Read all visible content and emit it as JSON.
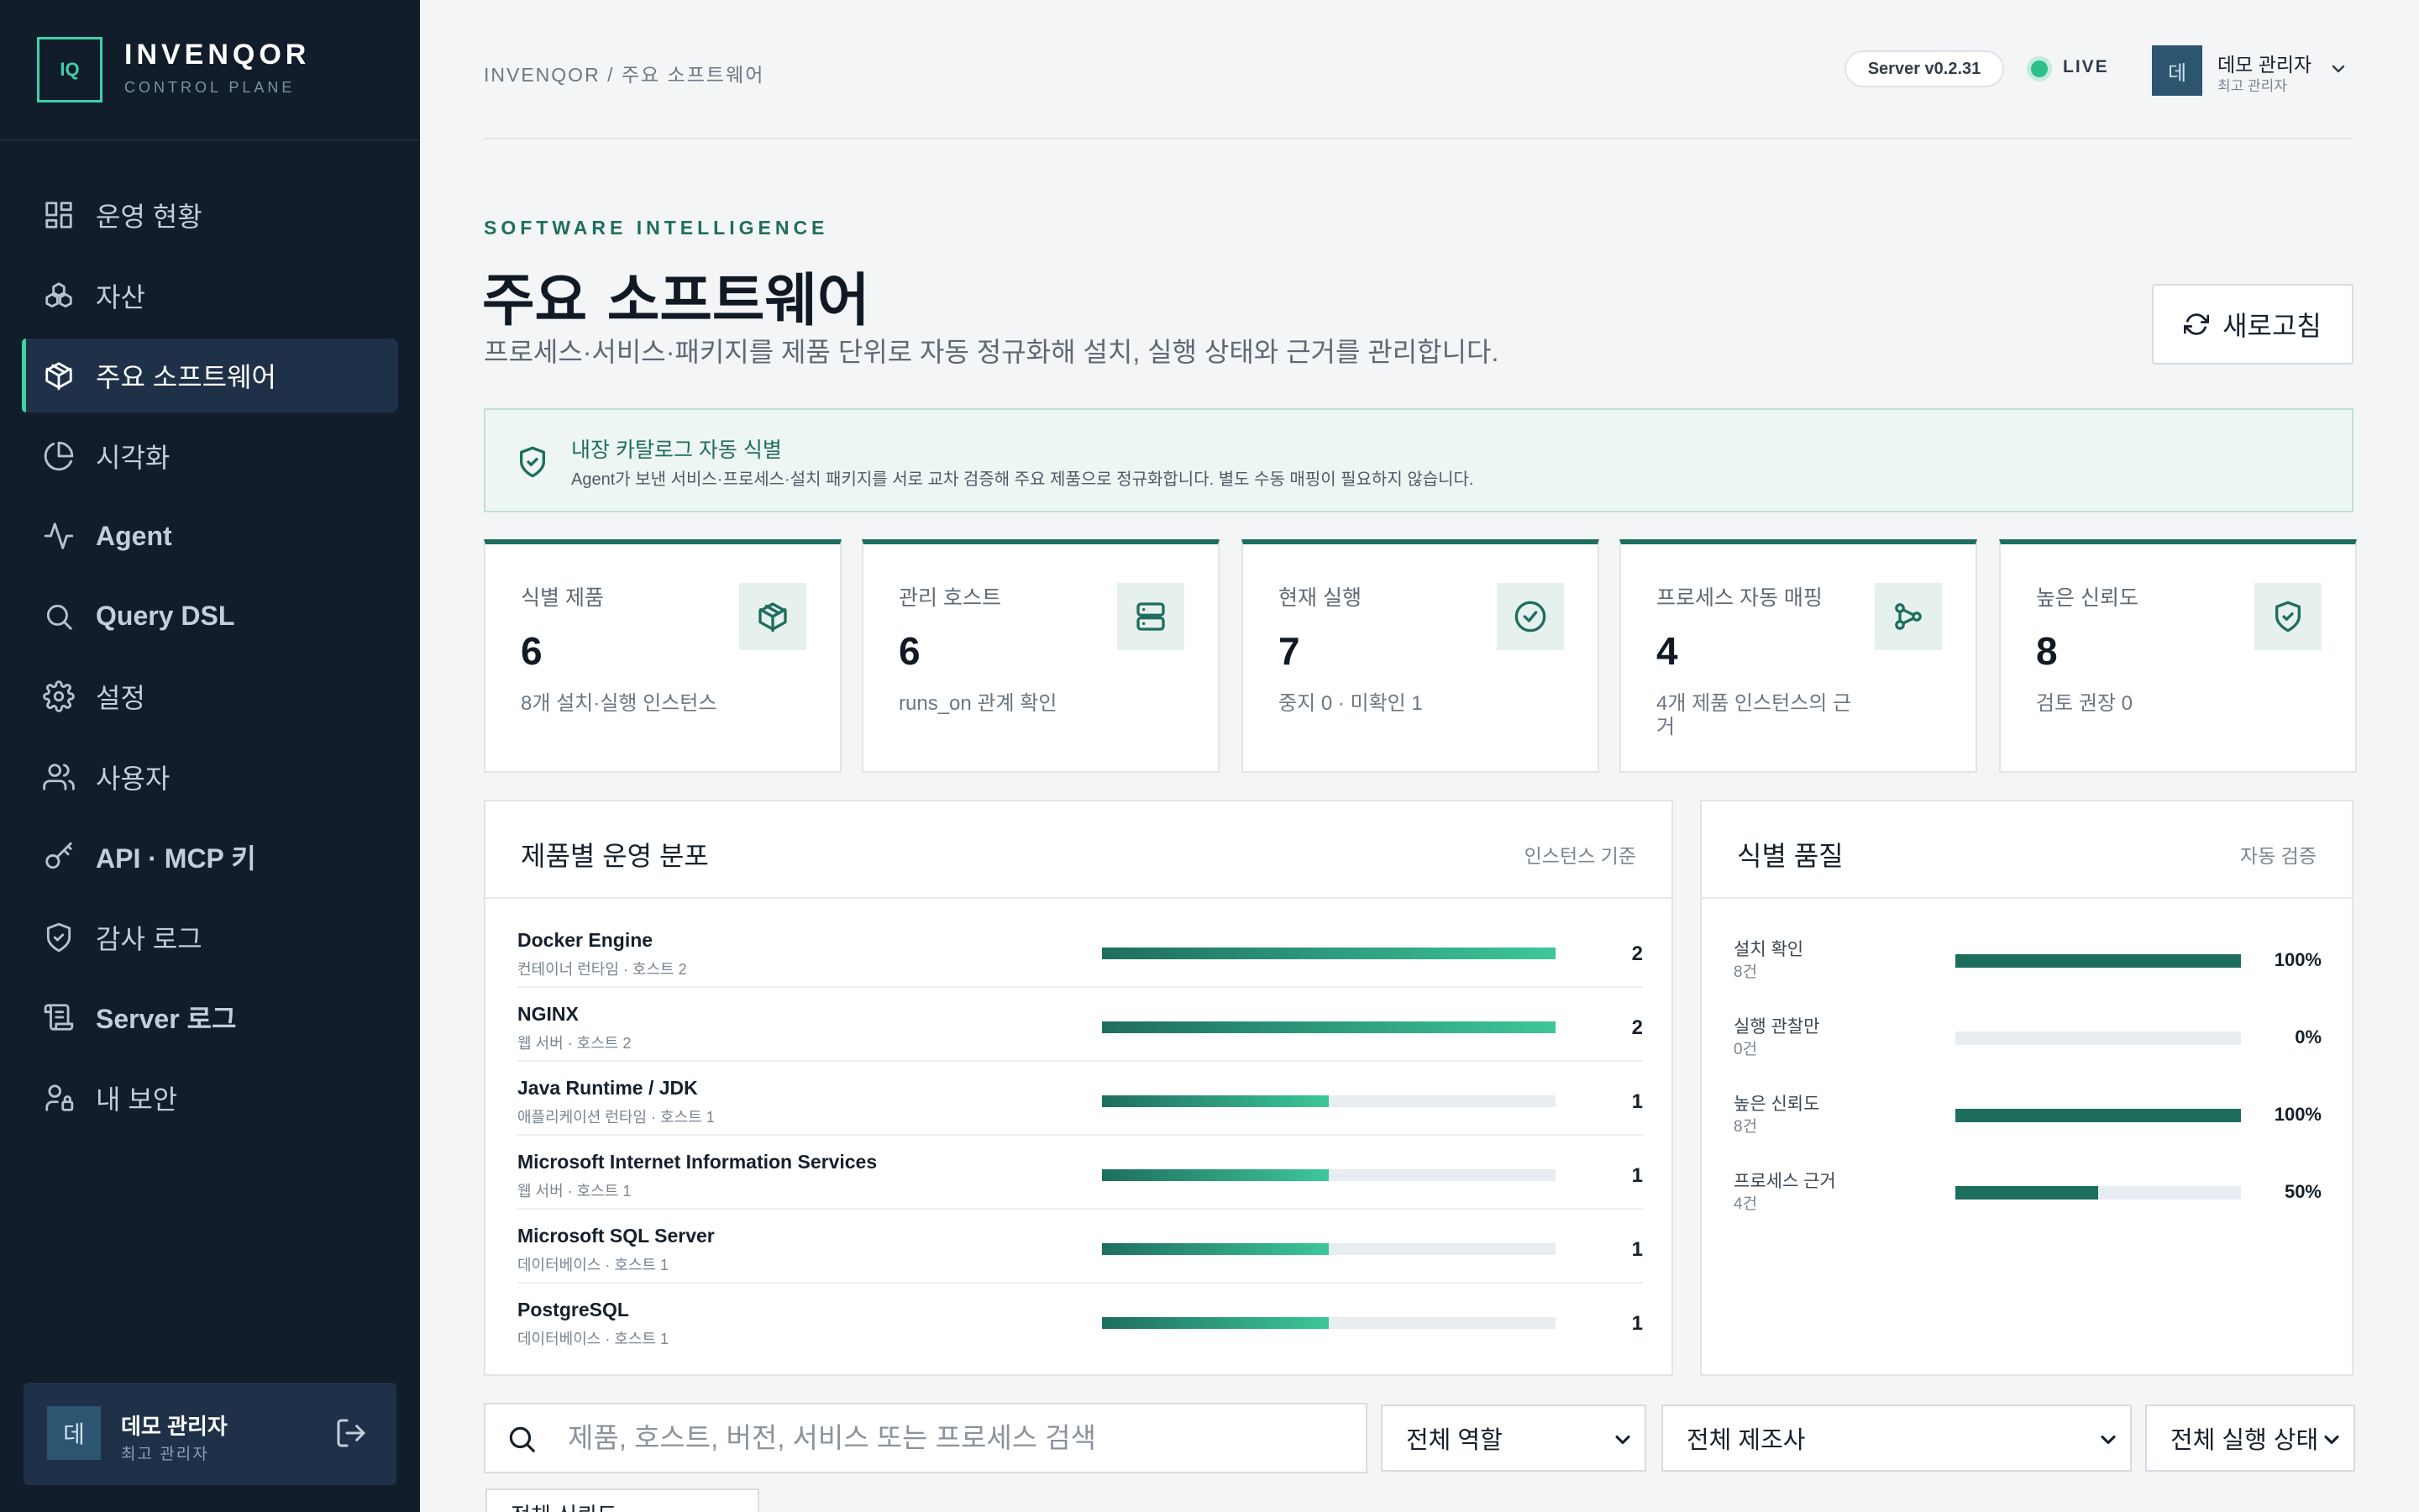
{
  "brand": {
    "logo_text": "IQ",
    "title": "INVENQOR",
    "subtitle": "CONTROL PLANE"
  },
  "nav": [
    {
      "label": "운영 현황",
      "icon": "dashboard-icon"
    },
    {
      "label": "자산",
      "icon": "assets-icon"
    },
    {
      "label": "주요 소프트웨어",
      "icon": "package-icon",
      "active": true
    },
    {
      "label": "시각화",
      "icon": "pie-chart-icon"
    },
    {
      "label": "Agent",
      "icon": "activity-icon"
    },
    {
      "label": "Query DSL",
      "icon": "search-icon"
    },
    {
      "label": "설정",
      "icon": "gear-icon"
    },
    {
      "label": "사용자",
      "icon": "users-icon"
    },
    {
      "label": "API · MCP 키",
      "icon": "key-icon"
    },
    {
      "label": "감사 로그",
      "icon": "shield-icon"
    },
    {
      "label": "Server 로그",
      "icon": "scroll-icon"
    },
    {
      "label": "내 보안",
      "icon": "user-lock-icon"
    }
  ],
  "sidebar_user": {
    "avatar": "데",
    "name": "데모 관리자",
    "role": "최고 관리자"
  },
  "topbar": {
    "breadcrumb": "INVENQOR / 주요 소프트웨어",
    "server_version": "Server v0.2.31",
    "live": "LIVE",
    "avatar": "데",
    "user_name": "데모 관리자",
    "user_role": "최고 관리자"
  },
  "header": {
    "eyebrow": "SOFTWARE INTELLIGENCE",
    "title": "주요 소프트웨어",
    "description": "프로세스·서비스·패키지를 제품 단위로 자동 정규화해 설치, 실행 상태와 근거를 관리합니다.",
    "refresh_label": "새로고침"
  },
  "banner": {
    "title": "내장 카탈로그 자동 식별",
    "text": "Agent가 보낸 서비스·프로세스·설치 패키지를 서로 교차 검증해 주요 제품으로 정규화합니다. 별도 수동 매핑이 필요하지 않습니다."
  },
  "stats": [
    {
      "label": "식별 제품",
      "value": "6",
      "sub": "8개 설치·실행 인스턴스",
      "icon": "package-icon"
    },
    {
      "label": "관리 호스트",
      "value": "6",
      "sub": "runs_on 관계 확인",
      "icon": "server-icon"
    },
    {
      "label": "현재 실행",
      "value": "7",
      "sub": "중지 0 · 미확인 1",
      "icon": "check-circle-icon"
    },
    {
      "label": "프로세스 자동 매핑",
      "value": "4",
      "sub": "4개 제품 인스턴스의 근거",
      "icon": "share-nodes-icon"
    },
    {
      "label": "높은 신뢰도",
      "value": "8",
      "sub": "검토 권장 0",
      "icon": "shield-check-icon"
    }
  ],
  "distribution": {
    "title": "제품별 운영 분포",
    "note": "인스턴스 기준",
    "max": 2,
    "rows": [
      {
        "name": "Docker Engine",
        "sub": "컨테이너 런타임 · 호스트 2",
        "count": 2
      },
      {
        "name": "NGINX",
        "sub": "웹 서버 · 호스트 2",
        "count": 2
      },
      {
        "name": "Java Runtime / JDK",
        "sub": "애플리케이션 런타임 · 호스트 1",
        "count": 1
      },
      {
        "name": "Microsoft Internet Information Services",
        "sub": "웹 서버 · 호스트 1",
        "count": 1
      },
      {
        "name": "Microsoft SQL Server",
        "sub": "데이터베이스 · 호스트 1",
        "count": 1
      },
      {
        "name": "PostgreSQL",
        "sub": "데이터베이스 · 호스트 1",
        "count": 1
      }
    ]
  },
  "quality": {
    "title": "식별 품질",
    "note": "자동 검증",
    "rows": [
      {
        "name": "설치 확인",
        "sub": "8건",
        "percent": 100,
        "label": "100%"
      },
      {
        "name": "실행 관찰만",
        "sub": "0건",
        "percent": 0,
        "label": "0%"
      },
      {
        "name": "높은 신뢰도",
        "sub": "8건",
        "percent": 100,
        "label": "100%"
      },
      {
        "name": "프로세스 근거",
        "sub": "4건",
        "percent": 50,
        "label": "50%"
      }
    ]
  },
  "filters": {
    "search_placeholder": "제품, 호스트, 버전, 서비스 또는 프로세스 검색",
    "role": "전체 역할",
    "vendor": "전체 제조사",
    "state": "전체 실행 상태",
    "extra": "전체 신뢰도"
  },
  "colors": {
    "accent": "#1e6e5e",
    "accent_light": "#3dc79a",
    "sidebar": "#111d2b",
    "live": "#2bbf8a"
  }
}
